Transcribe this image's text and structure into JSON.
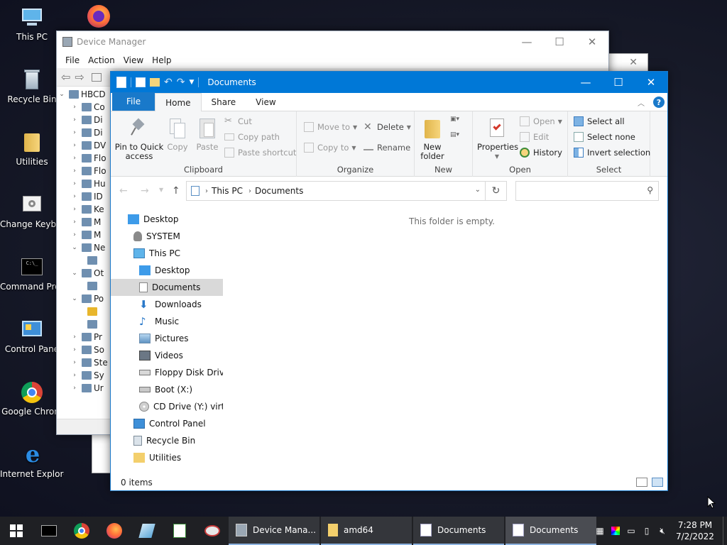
{
  "desktop": {
    "icons": [
      {
        "label": "This PC"
      },
      {
        "label": "Recycle Bin"
      },
      {
        "label": "Utilities"
      },
      {
        "label": "Change Keyboard Layo"
      },
      {
        "label": "Command Prompt"
      },
      {
        "label": "Control Pane"
      },
      {
        "label": "Google Chrom"
      },
      {
        "label": "Internet Explorer"
      }
    ]
  },
  "device_manager": {
    "title": "Device Manager",
    "menu": [
      "File",
      "Action",
      "View",
      "Help"
    ],
    "tree_root": "HBCD",
    "tree_items": [
      "Co",
      "Di",
      "Di",
      "DV",
      "Flo",
      "Flo",
      "Hu",
      "ID",
      "Ke",
      "M",
      "M",
      "Ne",
      "",
      "Ot",
      "",
      "Po",
      "",
      "",
      "Pr",
      "So",
      "Ste",
      "Sy",
      "Ur"
    ]
  },
  "explorer": {
    "title": "Documents",
    "tabs": {
      "file": "File",
      "home": "Home",
      "share": "Share",
      "view": "View"
    },
    "ribbon": {
      "clipboard": {
        "name": "Clipboard",
        "pin": "Pin to Quick access",
        "copy": "Copy",
        "paste": "Paste",
        "cut": "Cut",
        "copy_path": "Copy path",
        "paste_shortcut": "Paste shortcut"
      },
      "organize": {
        "name": "Organize",
        "move_to": "Move to",
        "copy_to": "Copy to",
        "delete": "Delete",
        "rename": "Rename"
      },
      "new": {
        "name": "New",
        "new_folder": "New folder"
      },
      "open": {
        "name": "Open",
        "properties": "Properties",
        "open": "Open",
        "edit": "Edit",
        "history": "History"
      },
      "select": {
        "name": "Select",
        "select_all": "Select all",
        "select_none": "Select none",
        "invert": "Invert selection"
      }
    },
    "address": {
      "root": "This PC",
      "current": "Documents"
    },
    "search_placeholder": "",
    "nav_items": [
      {
        "label": "Desktop",
        "level": 0
      },
      {
        "label": "SYSTEM",
        "level": 0
      },
      {
        "label": "This PC",
        "level": 0
      },
      {
        "label": "Desktop",
        "level": 1
      },
      {
        "label": "Documents",
        "level": 1
      },
      {
        "label": "Downloads",
        "level": 1
      },
      {
        "label": "Music",
        "level": 1
      },
      {
        "label": "Pictures",
        "level": 1
      },
      {
        "label": "Videos",
        "level": 1
      },
      {
        "label": "Floppy Disk Drive",
        "level": 1
      },
      {
        "label": "Boot (X:)",
        "level": 1
      },
      {
        "label": "CD Drive (Y:) virtic",
        "level": 1
      },
      {
        "label": "Control Panel",
        "level": 0
      },
      {
        "label": "Recycle Bin",
        "level": 0
      },
      {
        "label": "Utilities",
        "level": 0
      }
    ],
    "empty_message": "This folder is empty.",
    "status": "0 items"
  },
  "taskbar": {
    "tasks": [
      {
        "label": "Device Mana..."
      },
      {
        "label": "amd64"
      },
      {
        "label": "Documents"
      },
      {
        "label": "Documents"
      }
    ],
    "time": "7:28 PM",
    "date": "7/2/2022"
  },
  "colors": {
    "accent": "#0078d7",
    "taskbar": "#1f2024"
  }
}
